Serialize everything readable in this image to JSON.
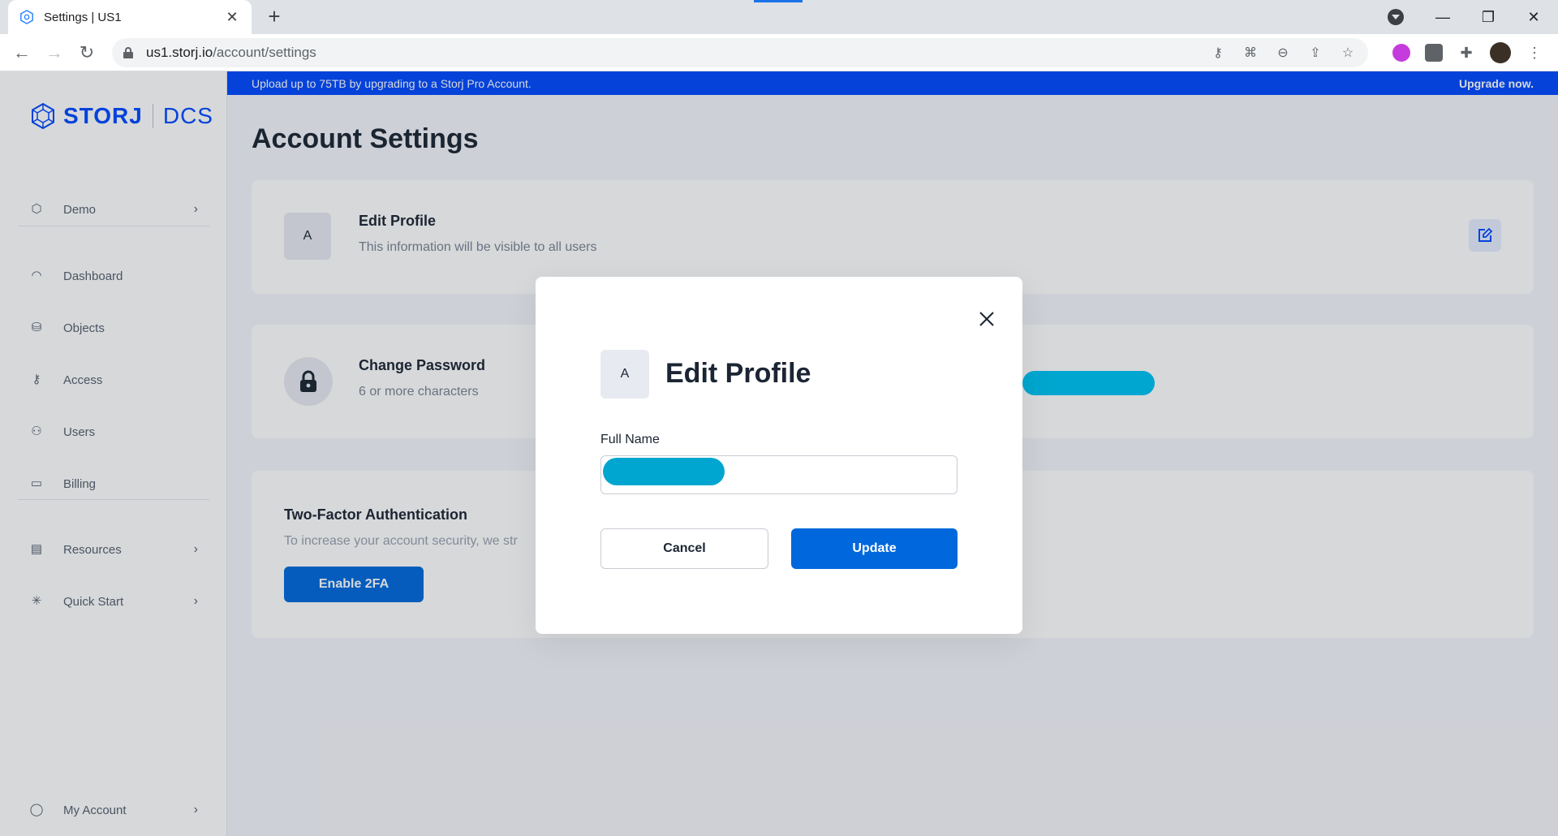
{
  "browser": {
    "tab_title": "Settings | US1",
    "url_host": "us1.storj.io",
    "url_path": "/account/settings",
    "new_tab": "+",
    "close_tab": "✕"
  },
  "sidebar": {
    "logo_text": "STORJ",
    "logo_product": "DCS",
    "project": "Demo",
    "items": [
      {
        "label": "Dashboard",
        "icon": "dashboard-icon"
      },
      {
        "label": "Objects",
        "icon": "objects-icon"
      },
      {
        "label": "Access",
        "icon": "key-icon"
      },
      {
        "label": "Users",
        "icon": "users-icon"
      },
      {
        "label": "Billing",
        "icon": "card-icon"
      }
    ],
    "resources": "Resources",
    "quick_start": "Quick Start",
    "my_account": "My Account"
  },
  "banner": {
    "text": "Upload up to 75TB by upgrading to a Storj Pro Account.",
    "link": "Upgrade now."
  },
  "page": {
    "title": "Account Settings",
    "profile": {
      "avatar": "A",
      "title": "Edit Profile",
      "subtitle": "This information will be visible to all users"
    },
    "password": {
      "title": "Change Password",
      "subtitle": "6 or more characters"
    },
    "twofa": {
      "title": "Two-Factor Authentication",
      "subtitle": "To increase your account security, we str",
      "button": "Enable 2FA"
    }
  },
  "modal": {
    "avatar": "A",
    "title": "Edit Profile",
    "field_label": "Full Name",
    "cancel": "Cancel",
    "update": "Update"
  },
  "colors": {
    "brand": "#0149ff",
    "primary_button": "#0068dc",
    "redaction": "#00a6cf"
  }
}
